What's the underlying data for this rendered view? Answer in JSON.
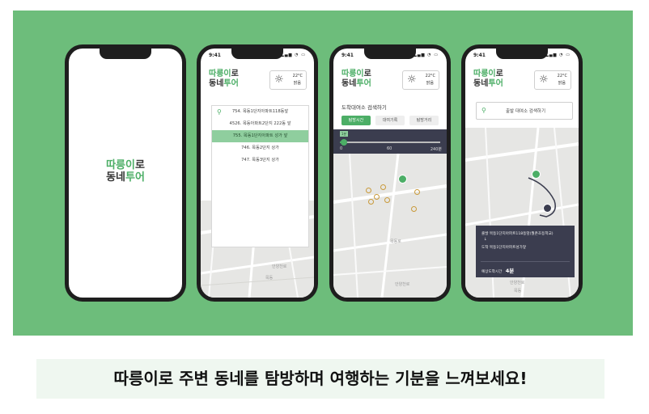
{
  "status": {
    "time": "9:41",
    "icons": "▂▄▆ ◔ ▭"
  },
  "logo": {
    "line1_green": "따릉이",
    "line1_rest": "로",
    "line2_rest": "동네",
    "line2_green": "투어"
  },
  "weather": {
    "icon": "sun-icon",
    "temp": "22°C",
    "condition": "맑음"
  },
  "phone2": {
    "search_icon": "search-icon",
    "results": [
      "754. 목동1단지아파트118동앞",
      "4526. 목동아파트2단지 222동 앞",
      "755. 목동1단지아파트 성가 앞",
      "746. 목동2단지 상가",
      "747. 목동3단지 상가"
    ],
    "active_index": 2
  },
  "phone3": {
    "title": "도착대여소 검색하기",
    "chips": [
      "탐방시간",
      "대여기록",
      "탐방거리"
    ],
    "active_chip": 0,
    "slider": {
      "value": "1분",
      "min_label": "0",
      "mid_label": "60",
      "max_label": "240분",
      "fraction": 0.04
    }
  },
  "phone4": {
    "search_text": "출발 대여소 검색하기",
    "card": {
      "start": "출발  목동1단지아파트118동앞(월촌초등학교)",
      "arrow": "↓",
      "end": "도착  목동1단지아파트성가앞",
      "eta_label": "예상도착시간",
      "eta_value": "4분"
    }
  },
  "map_labels": {
    "park": "목동공원",
    "road": "목동로",
    "road2": "안양천로",
    "area": "목동"
  },
  "caption": "따릉이로 주변 동네를 탐방하며 여행하는 기분을 느껴보세요!",
  "colors": {
    "background": "#6dbd7b",
    "accent": "#4cae66",
    "dark_panel": "#3b3d4f",
    "caption_bg": "#eff7f0"
  }
}
